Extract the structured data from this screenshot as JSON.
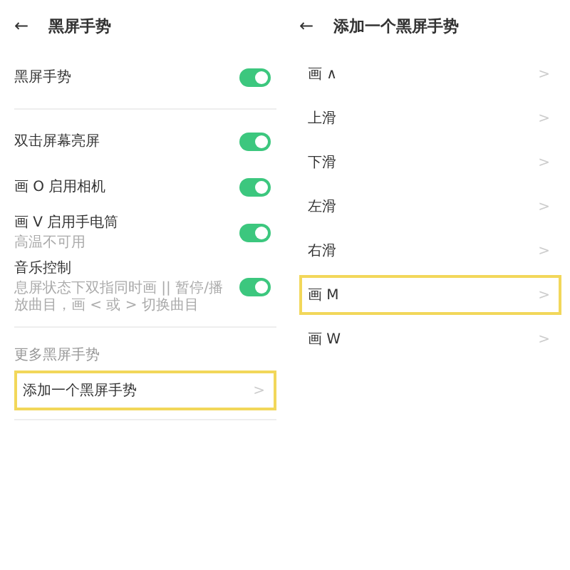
{
  "left": {
    "back": "←",
    "title": "黑屏手势",
    "master": {
      "label": "黑屏手势",
      "on": true
    },
    "toggles": [
      {
        "label": "双击屏幕亮屏",
        "on": true
      },
      {
        "label": "画 O 启用相机",
        "on": true
      },
      {
        "label": "画 V 启用手电筒",
        "caption": "高温不可用",
        "on": true
      },
      {
        "label": "音乐控制",
        "caption": "息屏状态下双指同时画 || 暂停/播放曲目，画 < 或 > 切换曲目",
        "on": true
      }
    ],
    "section": "更多黑屏手势",
    "add": {
      "label": "添加一个黑屏手势",
      "chevron": ">",
      "highlighted": true
    }
  },
  "right": {
    "back": "←",
    "title": "添加一个黑屏手势",
    "items": [
      {
        "label": "画 ∧",
        "chevron": ">",
        "highlighted": false
      },
      {
        "label": "上滑",
        "chevron": ">",
        "highlighted": false
      },
      {
        "label": "下滑",
        "chevron": ">",
        "highlighted": false
      },
      {
        "label": "左滑",
        "chevron": ">",
        "highlighted": false
      },
      {
        "label": "右滑",
        "chevron": ">",
        "highlighted": false
      },
      {
        "label": "画 M",
        "chevron": ">",
        "highlighted": true
      },
      {
        "label": "画 W",
        "chevron": ">",
        "highlighted": false
      }
    ]
  }
}
